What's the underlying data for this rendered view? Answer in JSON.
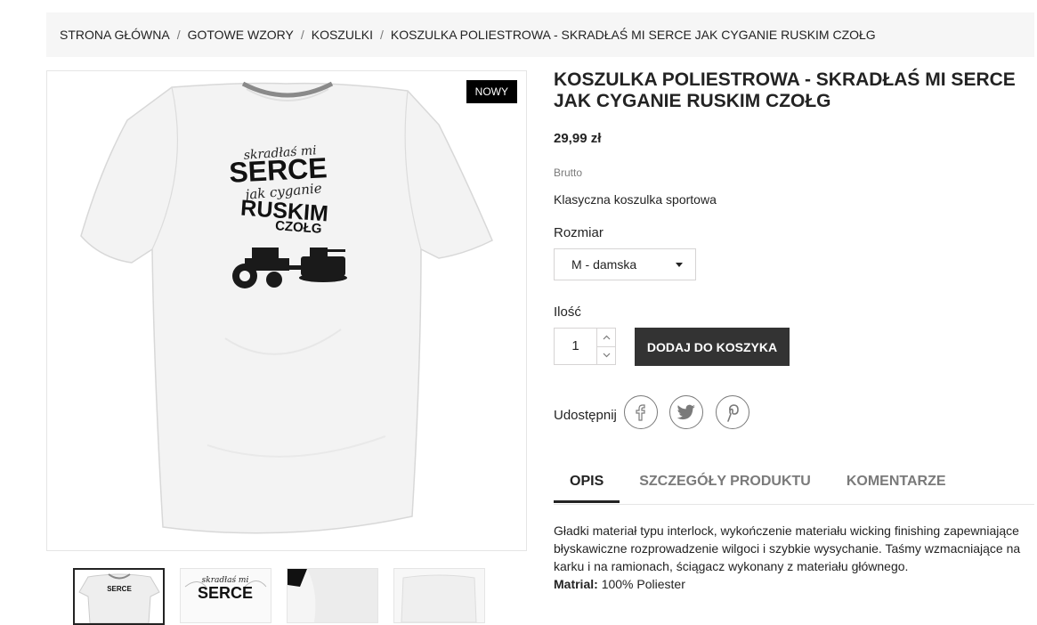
{
  "breadcrumb": [
    "Strona główna",
    "Gotowe wzory",
    "Koszulki",
    "Koszulka poliestrowa - Skradłaś mi serce jak Cyganie ruskim czołg"
  ],
  "badge": "Nowy",
  "tshirt_print": {
    "line1": "skradłaś mi",
    "line2": "SERCE",
    "line3": "jak cyganie",
    "line4": "RUSKIM",
    "line5": "CZOŁG"
  },
  "product": {
    "title": "Koszulka poliestrowa - Skradłaś mi serce jak Cyganie ruskim czołg",
    "price": "29,99 zł",
    "tax_label": "Brutto",
    "short_description": "Klasyczna koszulka sportowa",
    "size_label": "Rozmiar",
    "size_value": "M - damska",
    "qty_label": "Ilość",
    "qty_value": "1",
    "add_to_cart": "Dodaj do koszyka",
    "share_label": "Udostępnij"
  },
  "share_icons": [
    "facebook-icon",
    "twitter-icon",
    "pinterest-icon"
  ],
  "tabs": [
    "Opis",
    "Szczegóły produktu",
    "Komentarze"
  ],
  "description": {
    "text": "Gładki materiał typu interlock, wykończenie materiału wicking finishing zapewniające błyskawiczne rozprowadzenie wilgoci i szybkie wysychanie. Taśmy wzmacniające na karku i na ramionach, ściągacz wykonany z materiału głównego.",
    "material_label": "Matrial:",
    "material_value": "100% Poliester"
  },
  "thumbnails": {
    "t1_text": "SERCE",
    "t2_top": "skradłaś mi",
    "t2_text": "SERCE"
  },
  "colors": {
    "accent": "#232323",
    "button": "#333333",
    "breadcrumb_bg": "#f6f6f6"
  }
}
